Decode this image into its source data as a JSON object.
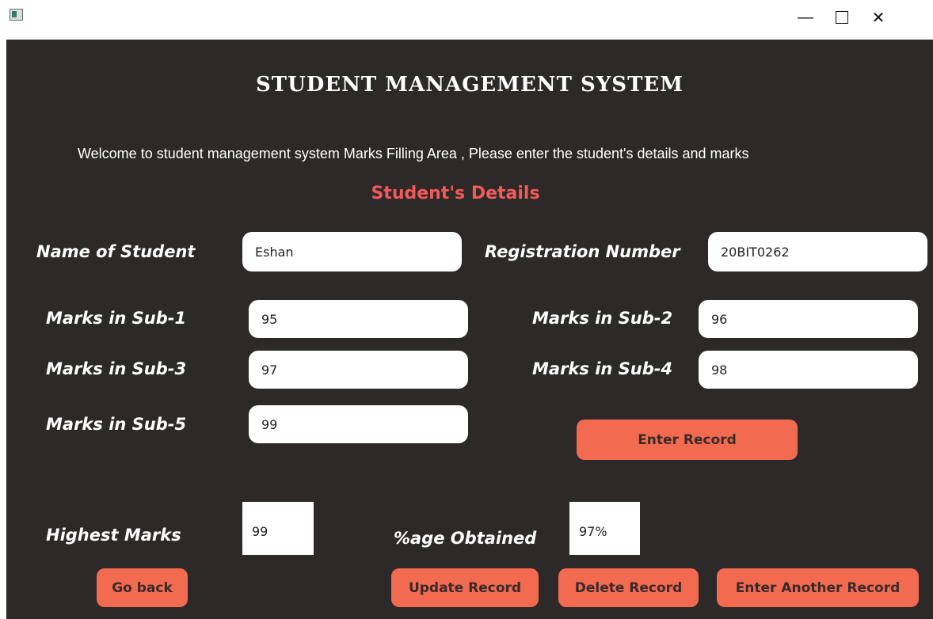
{
  "window": {
    "minimize_glyph": "—",
    "maximize_glyph": "☐",
    "close_glyph": "✕",
    "app_icon": "java-window-icon"
  },
  "header": {
    "title": "STUDENT MANAGEMENT SYSTEM",
    "welcome": "Welcome to student management system Marks Filling Area , Please enter the student's details and marks",
    "section_title": "Student's Details"
  },
  "form": {
    "name_label": "Name of Student",
    "name_value": "Eshan",
    "reg_label": "Registration Number",
    "reg_value": "20BIT0262",
    "sub1_label": "Marks in Sub-1",
    "sub1_value": "95",
    "sub2_label": "Marks in Sub-2",
    "sub2_value": "96",
    "sub3_label": "Marks in Sub-3",
    "sub3_value": "97",
    "sub4_label": "Marks in Sub-4",
    "sub4_value": "98",
    "sub5_label": "Marks in Sub-5",
    "sub5_value": "99",
    "enter_record_button": "Enter Record"
  },
  "results": {
    "highest_label": "Highest Marks",
    "highest_value": "99",
    "percentage_label": "%age Obtained",
    "percentage_value": "97%"
  },
  "actions": {
    "go_back": "Go back",
    "update": "Update Record",
    "delete": "Delete Record",
    "enter_another": "Enter Another Record"
  },
  "colors": {
    "background": "#2d2928",
    "accent_button": "#f26a4f",
    "section_title": "#f05a5a"
  }
}
